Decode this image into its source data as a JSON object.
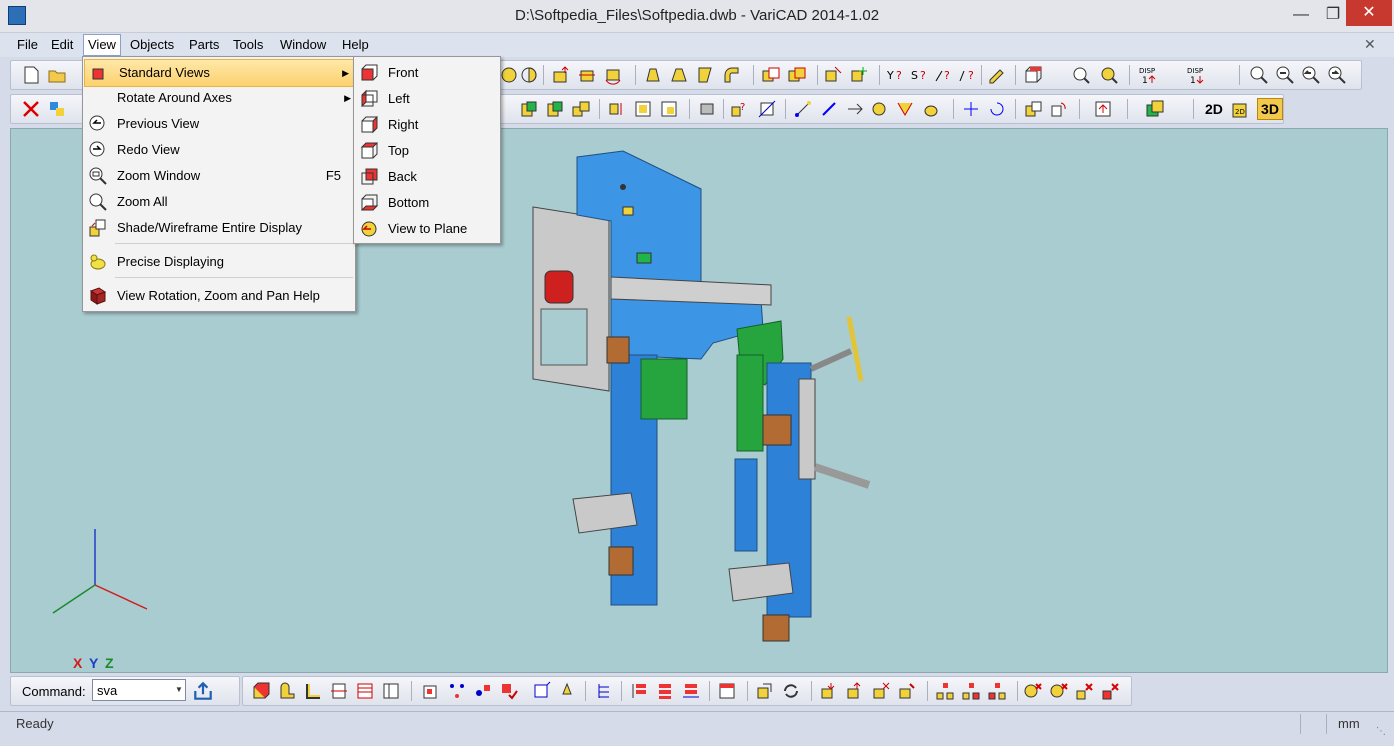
{
  "window": {
    "title": "D:\\Softpedia_Files\\Softpedia.dwb - VariCAD 2014-1.02"
  },
  "menubar": {
    "items": [
      "File",
      "Edit",
      "View",
      "Objects",
      "Parts",
      "Tools",
      "Window",
      "Help"
    ]
  },
  "view_menu": {
    "items": [
      {
        "label": "Standard Views",
        "shortcut": "",
        "submenu": true,
        "icon": "standard-views-icon"
      },
      {
        "label": "Rotate Around Axes",
        "shortcut": "",
        "submenu": true,
        "icon": ""
      },
      {
        "label": "Previous View",
        "shortcut": "",
        "submenu": false,
        "icon": "previous-view-icon"
      },
      {
        "label": "Redo View",
        "shortcut": "",
        "submenu": false,
        "icon": "redo-view-icon"
      },
      {
        "label": "Zoom Window",
        "shortcut": "F5",
        "submenu": false,
        "icon": "zoom-window-icon"
      },
      {
        "label": "Zoom All",
        "shortcut": "",
        "submenu": false,
        "icon": "zoom-all-icon"
      },
      {
        "label": "Shade/Wireframe Entire Display",
        "shortcut": "",
        "submenu": false,
        "icon": "shade-wireframe-icon"
      },
      {
        "label": "Precise Displaying",
        "shortcut": "",
        "submenu": false,
        "icon": "precise-displaying-icon"
      },
      {
        "label": "View Rotation, Zoom and Pan Help",
        "shortcut": "",
        "submenu": false,
        "icon": "help-book-icon"
      }
    ]
  },
  "standard_views_submenu": {
    "items": [
      "Front",
      "Left",
      "Right",
      "Top",
      "Back",
      "Bottom",
      "View to Plane"
    ]
  },
  "toolbar_modes": {
    "two_d": "2D",
    "three_d": "3D"
  },
  "axes": {
    "x": "X",
    "y": "Y",
    "z": "Z"
  },
  "command": {
    "label": "Command:",
    "value": "sva"
  },
  "status": {
    "text": "Ready",
    "unit": "mm"
  },
  "colors": {
    "canvas": "#a9ccd0",
    "menu_highlight": "#fcd16f",
    "part_blue": "#2f87e0",
    "part_green": "#1fa33a",
    "part_gray": "#c8c8c8"
  }
}
